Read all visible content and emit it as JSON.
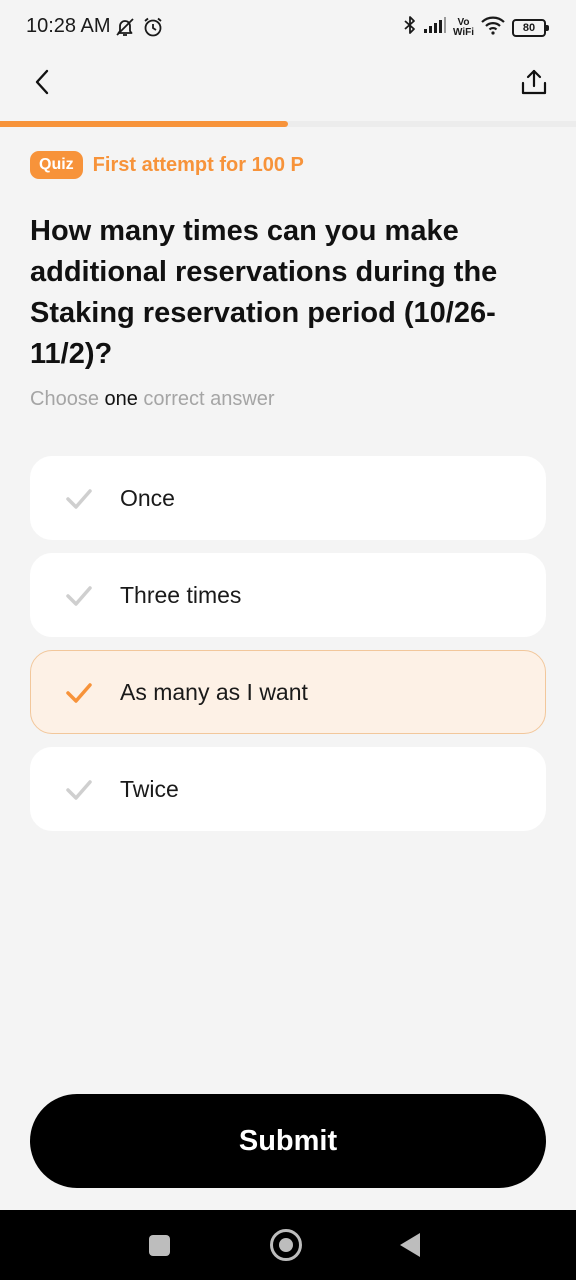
{
  "status_bar": {
    "time": "10:28 AM",
    "vo_label": "Vo",
    "wifi_label": "WiFi",
    "battery": "80",
    "icons": [
      "muted-bell-icon",
      "alarm-icon",
      "bluetooth-icon",
      "signal-icon",
      "wifi-icon",
      "battery-icon"
    ]
  },
  "header": {
    "back_icon": "chevron-left-icon",
    "share_icon": "share-upload-icon"
  },
  "progress": {
    "fraction": 0.5,
    "color": "#f7933a"
  },
  "quiz": {
    "badge": "Quiz",
    "reward": "First attempt for 100 P"
  },
  "question": {
    "text": "How many times can you make additional reservations during the Staking reservation period (10/26-11/2)?",
    "instruction_pre": "Choose ",
    "instruction_emph": "one",
    "instruction_post": " correct answer"
  },
  "options": [
    {
      "label": "Once",
      "selected": false
    },
    {
      "label": "Three times",
      "selected": false
    },
    {
      "label": "As many as I want",
      "selected": true
    },
    {
      "label": "Twice",
      "selected": false
    }
  ],
  "submit_label": "Submit",
  "colors": {
    "accent": "#f7933a",
    "selected_bg": "#fdf1e6",
    "check_inactive": "#cfcfcf"
  }
}
